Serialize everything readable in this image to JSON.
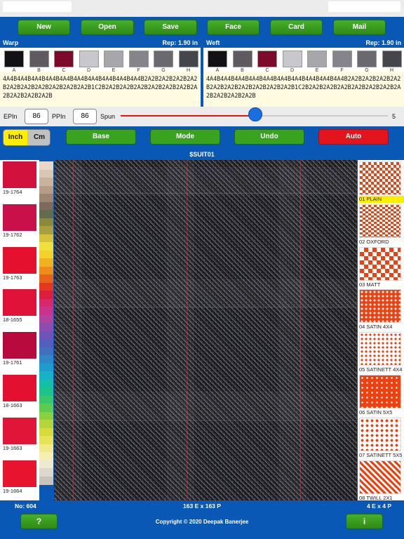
{
  "toolbar": {
    "buttons": [
      "New",
      "Open",
      "Save",
      "Face",
      "Card",
      "Mail"
    ]
  },
  "warp": {
    "title": "Warp",
    "repeat": "Rep: 1.90 in",
    "swatches": [
      {
        "letter": "A",
        "color": "#121215"
      },
      {
        "letter": "B",
        "color": "#5e5a60"
      },
      {
        "letter": "C",
        "color": "#7d0a2a"
      },
      {
        "letter": "D",
        "color": "#c8c7cb"
      },
      {
        "letter": "E",
        "color": "#a7a6ab"
      },
      {
        "letter": "F",
        "color": "#85848a"
      },
      {
        "letter": "G",
        "color": "#6a696f"
      },
      {
        "letter": "H",
        "color": "#45464b"
      }
    ],
    "code": "4A4B4A4B4A4B4A4B4A4B4A4B4A4B4A4B4A4B4A4B2A2B2A2B2A2B2A2B2A2B2A2B2A2B2A2B2A2B2A2B1C2B2A2B2A2B2A2B2A2B2A2B2A2B2A2B2A2B2A2B2A2B"
  },
  "weft": {
    "title": "Weft",
    "repeat": "Rep: 1.90 in",
    "swatches": [
      {
        "letter": "A",
        "color": "#121215"
      },
      {
        "letter": "B",
        "color": "#5e5a60"
      },
      {
        "letter": "C",
        "color": "#7d0a2a"
      },
      {
        "letter": "D",
        "color": "#c8c7cb"
      },
      {
        "letter": "E",
        "color": "#a7a6ab"
      },
      {
        "letter": "F",
        "color": "#85848a"
      },
      {
        "letter": "G",
        "color": "#6a696f"
      },
      {
        "letter": "H",
        "color": "#45464b"
      }
    ],
    "code": "4A4B4A4B4A4B4A4B4A4B4A4B4A4B4A4B4A4B4A4B2A2B2A2B2A2B2A2B2A2B2A2B2A2B2A2B2A2B2A2B1C2B2A2B2A2B2A2B2A2B2A2B2A2B2A2B2A2B2A2B2A2B"
  },
  "settings": {
    "epi_label": "EPIn",
    "epi_value": "86",
    "ppi_label": "PPIn",
    "ppi_value": "86",
    "spun_label": "Spun",
    "spun_value": "5",
    "spun_fraction": 0.505
  },
  "units": {
    "inch": "Inch",
    "cm": "Cm",
    "selected": "Inch"
  },
  "modes": [
    {
      "label": "Base",
      "color": "#39a320"
    },
    {
      "label": "Mode",
      "color": "#39a320"
    },
    {
      "label": "Undo",
      "color": "#39a320"
    },
    {
      "label": "Auto",
      "color": "#e3141c"
    }
  ],
  "design_title": "$SUIT01",
  "colors": [
    {
      "label": "19-1764",
      "color": "#d2113c"
    },
    {
      "label": "19-1762",
      "color": "#c9104a"
    },
    {
      "label": "19-1763",
      "color": "#e5102e"
    },
    {
      "label": "18-1655",
      "color": "#e0123a"
    },
    {
      "label": "19-1761",
      "color": "#b80a3d"
    },
    {
      "label": "18-1663",
      "color": "#e31030"
    },
    {
      "label": "19-1663",
      "color": "#e11538"
    },
    {
      "label": "19-1664",
      "color": "#e8132f"
    }
  ],
  "palette": [
    "#e8d8c8",
    "#d9c7b3",
    "#c9b39a",
    "#b59e86",
    "#9c8671",
    "#7c6a5a",
    "#606c4a",
    "#8c8a3a",
    "#a8a040",
    "#d6c23a",
    "#f1e03c",
    "#f4d22a",
    "#f0b21e",
    "#ef8c1a",
    "#e8621c",
    "#e4371e",
    "#de1f3b",
    "#d6286a",
    "#c9338d",
    "#b043a0",
    "#8e4cae",
    "#6d54b6",
    "#525fbc",
    "#3f70c2",
    "#2f86c9",
    "#1e9ccb",
    "#16b3c5",
    "#12c0a7",
    "#1cc38a",
    "#38c76c",
    "#5fcb4e",
    "#8ad03e",
    "#b3d63a",
    "#d5dc3c",
    "#e8e25a",
    "#f2ea86",
    "#f6efb2",
    "#efe9d2",
    "#dcd8cc",
    "#c8c4bc"
  ],
  "weaves": [
    {
      "label": "01 PLAIN",
      "selected": true,
      "pattern": "plain"
    },
    {
      "label": "02 OXFORD",
      "selected": false,
      "pattern": "oxford"
    },
    {
      "label": "03 MATT",
      "selected": false,
      "pattern": "matt"
    },
    {
      "label": "04 SATIN 4X4",
      "selected": false,
      "pattern": "satin4"
    },
    {
      "label": "05 SATINETT 4X4",
      "selected": false,
      "pattern": "satinett4"
    },
    {
      "label": "06 SATIN 5X5",
      "selected": false,
      "pattern": "satin5"
    },
    {
      "label": "07 SATINETT 5X5",
      "selected": false,
      "pattern": "satinett5"
    },
    {
      "label": "08 TWILL 2X1",
      "selected": false,
      "pattern": "twill"
    }
  ],
  "info": {
    "number": "No: 604",
    "ends_picks": "163 E x 163 P",
    "repeat": "4 E x 4 P"
  },
  "footer": {
    "help": "?",
    "copyright": "Copyright © 2020  Deepak Banerjee",
    "info": "i"
  }
}
